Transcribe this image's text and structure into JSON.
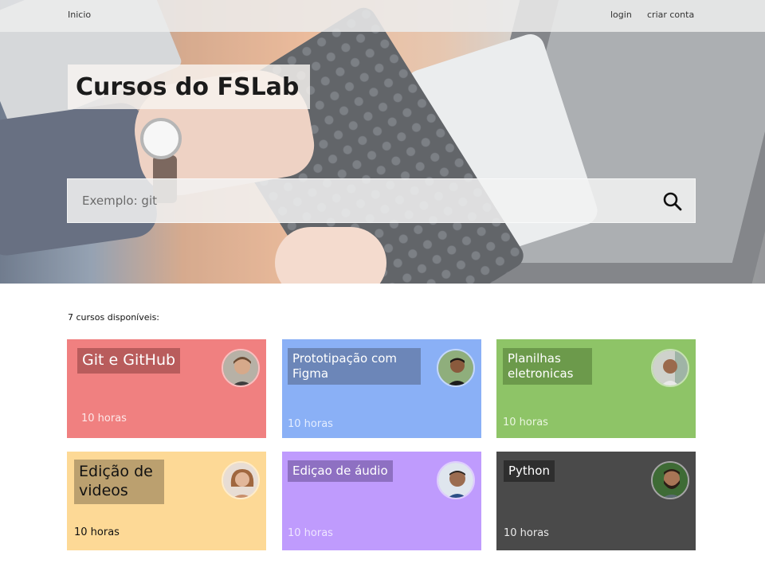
{
  "nav": {
    "home": "Inicio",
    "login": "login",
    "signup": "criar conta"
  },
  "hero": {
    "title": "Cursos do FSLab"
  },
  "search": {
    "placeholder": "Exemplo: git",
    "icon": "search-icon"
  },
  "courses_count": "7 cursos disponíveis:",
  "courses": [
    {
      "title": "Git e GitHub",
      "hours": "10 horas",
      "color": "#f08080"
    },
    {
      "title": "Prototipação com Figma",
      "hours": "10 horas",
      "color": "#8ab0f6"
    },
    {
      "title": "Planilhas eletronicas",
      "hours": "10 horas",
      "color": "#8ec467"
    },
    {
      "title": "Edição de videos",
      "hours": "10 horas",
      "color": "#fdd996"
    },
    {
      "title": "Ediçao de áudio",
      "hours": "10 horas",
      "color": "#bf9bfd"
    },
    {
      "title": "Python",
      "hours": "10 horas",
      "color": "#4a4a4a"
    }
  ]
}
